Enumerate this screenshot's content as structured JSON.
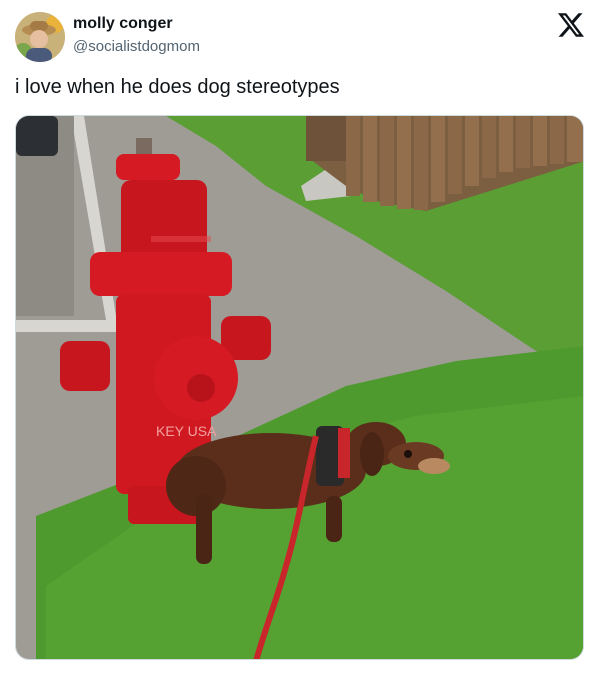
{
  "author": {
    "display_name": "molly conger",
    "handle": "@socialistdogmom",
    "avatar_icon": "avatar-photo"
  },
  "brand": {
    "logo_icon": "x-logo-icon"
  },
  "tweet": {
    "text": "i love when he does dog stereotypes"
  },
  "media": {
    "hydrant_markings": "KEY USA",
    "colors": {
      "hydrant": "#d61a23",
      "grass": "#4f9a2e",
      "gravel": "#9e9a94",
      "dog": "#5a2e1a",
      "leash": "#c8262a",
      "fence": "#8a6848"
    }
  }
}
